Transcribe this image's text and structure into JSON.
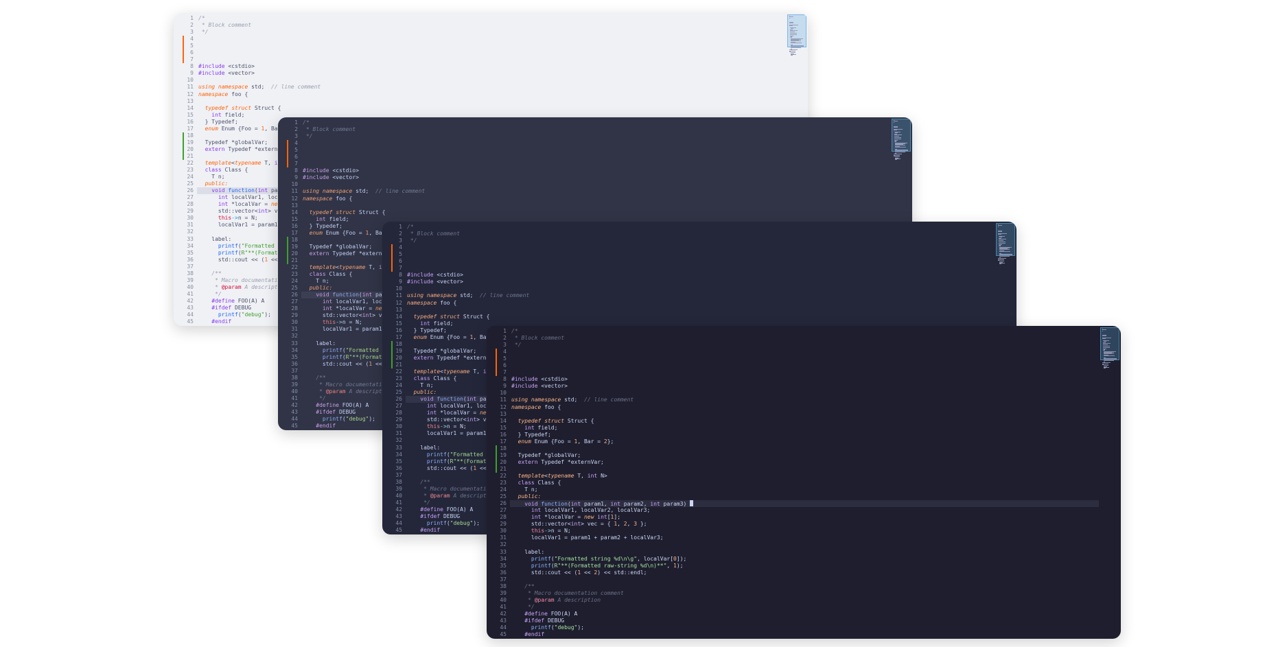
{
  "editors": [
    {
      "theme": "light",
      "background": "#eff1f5",
      "show_cursor": false
    },
    {
      "theme": "frappe",
      "background": "#303446",
      "show_cursor": false
    },
    {
      "theme": "macchiato",
      "background": "#24273a",
      "show_cursor": false
    },
    {
      "theme": "mocha",
      "background": "#1e1e2e",
      "show_cursor": true
    }
  ],
  "active_line": 26,
  "gutter_marks": {
    "modified_lines": [
      4,
      5,
      6,
      7
    ],
    "added_lines": [
      18,
      19,
      20,
      21
    ],
    "modified_color": "#fe640b",
    "added_color": "#40a02b"
  },
  "code_lines": [
    {
      "n": "1",
      "tokens": [
        [
          "c",
          "/*"
        ]
      ]
    },
    {
      "n": "2",
      "tokens": [
        [
          "c",
          " * Block comment"
        ]
      ]
    },
    {
      "n": "3",
      "tokens": [
        [
          "c",
          " */"
        ]
      ]
    },
    {
      "n": "4",
      "tokens": []
    },
    {
      "n": "5",
      "tokens": []
    },
    {
      "n": "6",
      "tokens": []
    },
    {
      "n": "7",
      "tokens": []
    },
    {
      "n": "8",
      "tokens": [
        [
          "k",
          "#include"
        ],
        [
          "t",
          " <cstdio>"
        ]
      ]
    },
    {
      "n": "9",
      "tokens": [
        [
          "k",
          "#include"
        ],
        [
          "t",
          " <vector>"
        ]
      ]
    },
    {
      "n": "10",
      "tokens": []
    },
    {
      "n": "11",
      "tokens": [
        [
          "kw",
          "using"
        ],
        [
          "t",
          " "
        ],
        [
          "kw",
          "namespace"
        ],
        [
          "t",
          " std;  "
        ],
        [
          "c",
          "// line comment"
        ]
      ]
    },
    {
      "n": "12",
      "tokens": [
        [
          "kw",
          "namespace"
        ],
        [
          "t",
          " foo {"
        ]
      ]
    },
    {
      "n": "13",
      "tokens": []
    },
    {
      "n": "14",
      "tokens": [
        [
          "t",
          "  "
        ],
        [
          "kw",
          "typedef"
        ],
        [
          "t",
          " "
        ],
        [
          "kw",
          "struct"
        ],
        [
          "t",
          " Struct {"
        ]
      ]
    },
    {
      "n": "15",
      "tokens": [
        [
          "t",
          "    "
        ],
        [
          "k",
          "int"
        ],
        [
          "t",
          " field;"
        ]
      ]
    },
    {
      "n": "16",
      "tokens": [
        [
          "t",
          "  } Typedef;"
        ]
      ]
    },
    {
      "n": "17",
      "tokens": [
        [
          "t",
          "  "
        ],
        [
          "kw",
          "enum"
        ],
        [
          "t",
          " Enum {Foo = "
        ],
        [
          "n",
          "1"
        ],
        [
          "t",
          ", Bar = "
        ],
        [
          "n",
          "2"
        ],
        [
          "t",
          "};"
        ]
      ]
    },
    {
      "n": "18",
      "tokens": []
    },
    {
      "n": "19",
      "tokens": [
        [
          "t",
          "  Typedef *globalVar;"
        ]
      ]
    },
    {
      "n": "20",
      "tokens": [
        [
          "t",
          "  "
        ],
        [
          "k",
          "extern"
        ],
        [
          "t",
          " Typedef *externVar;"
        ]
      ]
    },
    {
      "n": "21",
      "tokens": []
    },
    {
      "n": "22",
      "tokens": [
        [
          "t",
          "  "
        ],
        [
          "kw",
          "template"
        ],
        [
          "t",
          "<"
        ],
        [
          "kw",
          "typename"
        ],
        [
          "t",
          " T, "
        ],
        [
          "k",
          "int"
        ],
        [
          "t",
          " N>"
        ]
      ]
    },
    {
      "n": "23",
      "tokens": [
        [
          "t",
          "  "
        ],
        [
          "k",
          "class"
        ],
        [
          "t",
          " Class {"
        ]
      ]
    },
    {
      "n": "24",
      "tokens": [
        [
          "t",
          "    T n;"
        ]
      ]
    },
    {
      "n": "25",
      "tokens": [
        [
          "t",
          "  "
        ],
        [
          "kw",
          "public:"
        ]
      ]
    },
    {
      "n": "26",
      "tokens": [
        [
          "t",
          "    "
        ],
        [
          "k",
          "void"
        ],
        [
          "t",
          " "
        ],
        [
          "fn",
          "function"
        ],
        [
          "t",
          "("
        ],
        [
          "k",
          "int"
        ],
        [
          "t",
          " param1, "
        ],
        [
          "k",
          "int"
        ],
        [
          "t",
          " param2, "
        ],
        [
          "k",
          "int"
        ],
        [
          "t",
          " param3) "
        ]
      ]
    },
    {
      "n": "27",
      "tokens": [
        [
          "t",
          "      "
        ],
        [
          "k",
          "int"
        ],
        [
          "t",
          " localVar1, localVar2, localVar3;"
        ]
      ]
    },
    {
      "n": "28",
      "tokens": [
        [
          "t",
          "      "
        ],
        [
          "k",
          "int"
        ],
        [
          "t",
          " *localVar = "
        ],
        [
          "kw",
          "new"
        ],
        [
          "t",
          " "
        ],
        [
          "k",
          "int"
        ],
        [
          "t",
          "["
        ],
        [
          "n",
          "1"
        ],
        [
          "t",
          "];"
        ]
      ]
    },
    {
      "n": "29",
      "tokens": [
        [
          "t",
          "      std::vector<"
        ],
        [
          "k",
          "int"
        ],
        [
          "t",
          "> vec = { "
        ],
        [
          "n",
          "1"
        ],
        [
          "t",
          ", "
        ],
        [
          "n",
          "2"
        ],
        [
          "t",
          ", "
        ],
        [
          "n",
          "3"
        ],
        [
          "t",
          " };"
        ]
      ]
    },
    {
      "n": "30",
      "tokens": [
        [
          "t",
          "      "
        ],
        [
          "at",
          "this"
        ],
        [
          "op",
          "->"
        ],
        [
          "t",
          "n = N;"
        ]
      ]
    },
    {
      "n": "31",
      "tokens": [
        [
          "t",
          "      localVar1 = param1 + param2 + localVar3;"
        ]
      ]
    },
    {
      "n": "32",
      "tokens": []
    },
    {
      "n": "33",
      "tokens": [
        [
          "t",
          "    label:"
        ]
      ]
    },
    {
      "n": "34",
      "tokens": [
        [
          "t",
          "      "
        ],
        [
          "fn",
          "printf"
        ],
        [
          "t",
          "("
        ],
        [
          "s",
          "\"Formatted string %d\\n\\g\""
        ],
        [
          "t",
          ", localVar["
        ],
        [
          "n",
          "0"
        ],
        [
          "t",
          "]);"
        ]
      ]
    },
    {
      "n": "35",
      "tokens": [
        [
          "t",
          "      "
        ],
        [
          "fn",
          "printf"
        ],
        [
          "t",
          "("
        ],
        [
          "s",
          "R\"**(Formatted raw-string %d\\n)**\""
        ],
        [
          "t",
          ", "
        ],
        [
          "n",
          "1"
        ],
        [
          "t",
          ");"
        ]
      ]
    },
    {
      "n": "36",
      "tokens": [
        [
          "t",
          "      std::cout << ("
        ],
        [
          "n",
          "1"
        ],
        [
          "t",
          " << "
        ],
        [
          "n",
          "2"
        ],
        [
          "t",
          ") << std::endl;"
        ]
      ]
    },
    {
      "n": "37",
      "tokens": []
    },
    {
      "n": "38",
      "tokens": [
        [
          "t",
          "    "
        ],
        [
          "c",
          "/**"
        ]
      ]
    },
    {
      "n": "39",
      "tokens": [
        [
          "c",
          "     * Macro documentation comment"
        ]
      ]
    },
    {
      "n": "40",
      "tokens": [
        [
          "c",
          "     * "
        ],
        [
          "at",
          "@param"
        ],
        [
          "c",
          " A description"
        ]
      ]
    },
    {
      "n": "41",
      "tokens": [
        [
          "c",
          "     */"
        ]
      ]
    },
    {
      "n": "42",
      "tokens": [
        [
          "t",
          "    "
        ],
        [
          "k",
          "#define"
        ],
        [
          "t",
          " FOO(A) A"
        ]
      ]
    },
    {
      "n": "43",
      "tokens": [
        [
          "t",
          "    "
        ],
        [
          "k",
          "#ifdef"
        ],
        [
          "t",
          " DEBUG"
        ]
      ]
    },
    {
      "n": "44",
      "tokens": [
        [
          "t",
          "      "
        ],
        [
          "fn",
          "printf"
        ],
        [
          "t",
          "("
        ],
        [
          "s",
          "\"debug\""
        ],
        [
          "t",
          ");"
        ]
      ]
    },
    {
      "n": "45",
      "tokens": [
        [
          "t",
          "    "
        ],
        [
          "k",
          "#endif"
        ]
      ]
    }
  ]
}
